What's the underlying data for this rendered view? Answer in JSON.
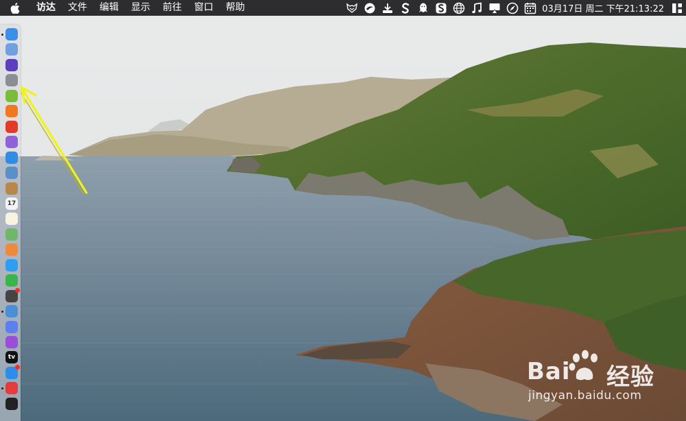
{
  "menubar": {
    "apple_icon": "apple-logo-icon",
    "items": [
      {
        "label": "访达",
        "bold": true
      },
      {
        "label": "文件"
      },
      {
        "label": "编辑"
      },
      {
        "label": "显示"
      },
      {
        "label": "前往"
      },
      {
        "label": "窗口"
      },
      {
        "label": "帮助"
      }
    ],
    "status_icons": [
      "fox-icon",
      "vpn-ball-icon",
      "download-icon",
      "s-app-icon",
      "qq-icon",
      "sogou-input-icon",
      "globe-icon",
      "music-note-icon",
      "airplay-display-icon",
      "compass-icon",
      "calendar-icon"
    ],
    "clock": "03月17日 周二 下午21:13:22",
    "control_icon": "control-center-icon"
  },
  "dock": {
    "items": [
      {
        "name": "finder-icon",
        "color": "#3b8fe6",
        "running": true
      },
      {
        "name": "system-preferences-icon",
        "color": "#6fa0e0"
      },
      {
        "name": "siri-icon",
        "color": "#5a3fbf"
      },
      {
        "name": "launchpad-icon",
        "color": "#8a8f96"
      },
      {
        "name": "android-icon",
        "color": "#7bbd3a"
      },
      {
        "name": "firefox-icon",
        "color": "#f0781e"
      },
      {
        "name": "red-app-icon",
        "color": "#e23b2a"
      },
      {
        "name": "purple-app-icon",
        "color": "#8f63d8"
      },
      {
        "name": "safari-icon",
        "color": "#2f8de4"
      },
      {
        "name": "preview-icon",
        "color": "#5b8fc8"
      },
      {
        "name": "notes-icon",
        "color": "#b8874a"
      },
      {
        "name": "calendar-dock-icon",
        "color": "#f4f4f4",
        "label": "17"
      },
      {
        "name": "stickies-icon",
        "color": "#f6f3e0"
      },
      {
        "name": "maps-icon",
        "color": "#6fb86a"
      },
      {
        "name": "photos-icon",
        "color": "#ee8a3b"
      },
      {
        "name": "messages-icon",
        "color": "#2f9ef0"
      },
      {
        "name": "wechat-icon",
        "color": "#39b54a"
      },
      {
        "name": "dark-app-icon",
        "color": "#444",
        "badge": true
      },
      {
        "name": "xcode-icon",
        "color": "#4b8fd6",
        "running": true
      },
      {
        "name": "itunes-icon",
        "color": "#5d7ff0"
      },
      {
        "name": "podcasts-icon",
        "color": "#9a4ed8"
      },
      {
        "name": "apple-tv-icon",
        "color": "#111",
        "label": "tv"
      },
      {
        "name": "app-store-icon",
        "color": "#2d8de8",
        "badge": true
      },
      {
        "name": "vivaldi-icon",
        "color": "#e23c3c",
        "running": true
      },
      {
        "name": "terminal-icon",
        "color": "#222"
      }
    ]
  },
  "annotation": {
    "color": "#f0f21c"
  },
  "watermark": {
    "brand_left": "Bai",
    "brand_right": "经验",
    "url": "jingyan.baidu.com"
  }
}
